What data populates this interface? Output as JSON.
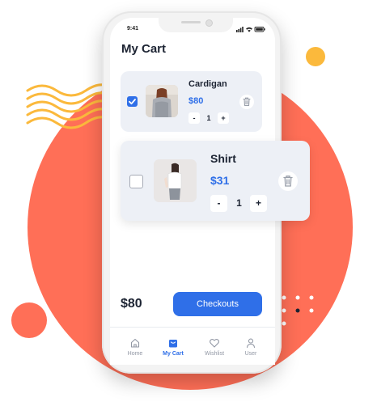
{
  "status": {
    "time": "9:41"
  },
  "page": {
    "title": "My Cart"
  },
  "cart": {
    "items": [
      {
        "name": "Cardigan",
        "price": "$80",
        "quantity": "1",
        "selected": true
      },
      {
        "name": "Shirt",
        "price": "$31",
        "quantity": "1",
        "selected": false
      }
    ],
    "stepper": {
      "minus": "-",
      "plus": "+"
    }
  },
  "summary": {
    "total": "$80",
    "checkout_label": "Checkouts"
  },
  "nav": {
    "items": [
      {
        "label": "Home",
        "icon": "home-icon",
        "active": false
      },
      {
        "label": "My Cart",
        "icon": "cart-icon",
        "active": true
      },
      {
        "label": "Wishlist",
        "icon": "heart-icon",
        "active": false
      },
      {
        "label": "User",
        "icon": "user-icon",
        "active": false
      }
    ]
  },
  "colors": {
    "accent": "#2f6fe8",
    "background_circle": "#ff6f57",
    "yellow_dot": "#fbb93c",
    "card_bg": "#edf0f6"
  }
}
